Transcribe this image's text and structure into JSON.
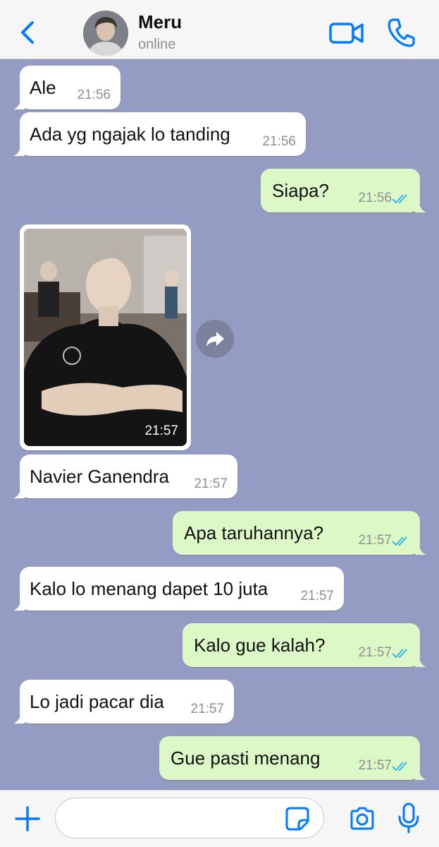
{
  "header": {
    "contact_name": "Meru",
    "contact_status": "online",
    "icons": [
      "chevron-left-icon",
      "avatar",
      "video-camera-icon",
      "phone-icon"
    ]
  },
  "messages": [
    {
      "direction": "in",
      "text": "Ale",
      "time": "21:56"
    },
    {
      "direction": "in",
      "text": "Ada yg ngajak lo tanding",
      "time": "21:56"
    },
    {
      "direction": "out",
      "text": "Siapa?",
      "time": "21:56",
      "read": true
    },
    {
      "direction": "in",
      "type": "image",
      "time": "21:57"
    },
    {
      "direction": "in",
      "text": "Navier Ganendra",
      "time": "21:57"
    },
    {
      "direction": "out",
      "text": "Apa taruhannya?",
      "time": "21:57",
      "read": true
    },
    {
      "direction": "in",
      "text": "Kalo lo menang dapet 10 juta",
      "time": "21:57"
    },
    {
      "direction": "out",
      "text": "Kalo gue kalah?",
      "time": "21:57",
      "read": true
    },
    {
      "direction": "in",
      "text": "Lo jadi pacar dia",
      "time": "21:57"
    },
    {
      "direction": "out",
      "text": "Gue pasti menang",
      "time": "21:57",
      "read": true
    }
  ],
  "input_bar": {
    "message_value": "",
    "icons": [
      "plus-icon",
      "sticker-icon",
      "camera-icon",
      "microphone-icon"
    ]
  },
  "colors": {
    "accent": "#007aff",
    "chat_background": "#949cc4",
    "incoming_bubble": "#ffffff",
    "outgoing_bubble": "#dcf8c6",
    "read_ticks": "#34b7f1"
  }
}
